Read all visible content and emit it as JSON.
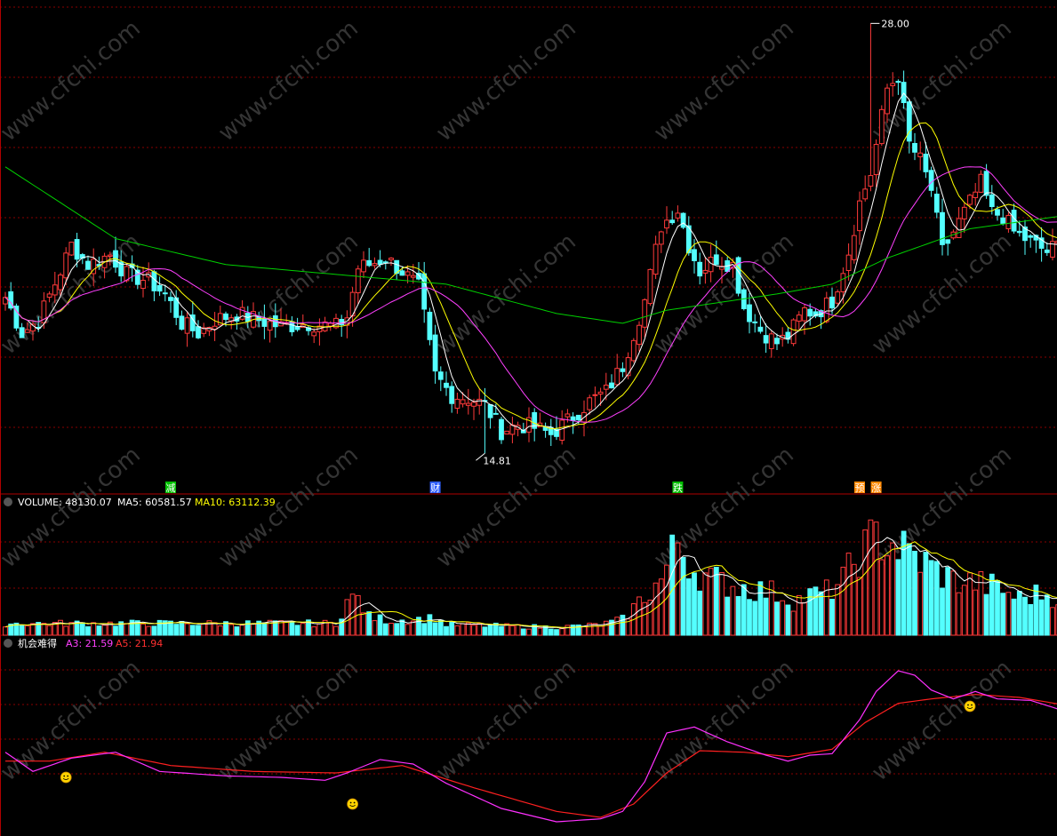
{
  "colors": {
    "background": "#000000",
    "grid": "#8a0000",
    "up": "#ff3a3a",
    "down": "#54ffff",
    "ma_white": "#ffffff",
    "ma_yellow": "#ffff00",
    "ma_magenta": "#ff40ff",
    "ma_green": "#00d000",
    "a3": "#ff30ff",
    "a5": "#ff2020",
    "smiley": "#ffd400",
    "text_white": "#ffffff",
    "text_yellow": "#ffff00",
    "text_magenta": "#ff40ff",
    "text_red": "#ff3030"
  },
  "watermark": "www.cfchi.com",
  "price_panel": {
    "high_label": "28.00",
    "low_label": "14.81",
    "signals": [
      {
        "text": "减",
        "index": 30,
        "color": "#00c000"
      },
      {
        "text": "财",
        "index": 78,
        "color": "#3060ff"
      },
      {
        "text": "跌",
        "index": 122,
        "color": "#00c000"
      },
      {
        "text": "预",
        "index": 155,
        "color": "#ff8800"
      },
      {
        "text": "涨",
        "index": 158,
        "color": "#ff8800"
      }
    ]
  },
  "volume_panel": {
    "title": "VOLUME: 48130.07",
    "ma5_label": "MA5: 60581.57",
    "ma10_label": "MA10: 63112.39"
  },
  "indicator_panel": {
    "title": "机会难得",
    "a3_label": "A3: 21.59",
    "a5_label": "A5: 21.94",
    "smileys": [
      {
        "index": 11,
        "value": 17.6
      },
      {
        "index": 63,
        "value": 15.8
      },
      {
        "index": 175,
        "value": 22.4
      }
    ]
  },
  "chart_data": {
    "type": "candlestick",
    "count": 193,
    "price_range": [
      14.0,
      28.5
    ],
    "volume_range": [
      0,
      95000
    ],
    "indicator_range": [
      14,
      26
    ],
    "close_keypoints": [
      [
        0,
        19.6
      ],
      [
        3,
        18.5
      ],
      [
        6,
        18.9
      ],
      [
        10,
        20.4
      ],
      [
        12,
        21.2
      ],
      [
        15,
        20.6
      ],
      [
        19,
        20.9
      ],
      [
        22,
        20.3
      ],
      [
        26,
        20.1
      ],
      [
        29,
        19.7
      ],
      [
        32,
        18.8
      ],
      [
        35,
        18.5
      ],
      [
        38,
        18.9
      ],
      [
        42,
        19.1
      ],
      [
        46,
        18.9
      ],
      [
        50,
        18.7
      ],
      [
        55,
        18.8
      ],
      [
        60,
        18.7
      ],
      [
        62,
        19.0
      ],
      [
        64,
        20.5
      ],
      [
        66,
        20.6
      ],
      [
        69,
        20.8
      ],
      [
        72,
        20.4
      ],
      [
        75,
        19.9
      ],
      [
        78,
        17.2
      ],
      [
        81,
        16.6
      ],
      [
        84,
        16.5
      ],
      [
        87,
        16.3
      ],
      [
        90,
        15.5
      ],
      [
        93,
        15.7
      ],
      [
        96,
        15.6
      ],
      [
        99,
        15.4
      ],
      [
        102,
        15.8
      ],
      [
        106,
        16.4
      ],
      [
        109,
        16.7
      ],
      [
        112,
        17.5
      ],
      [
        116,
        19.5
      ],
      [
        119,
        21.8
      ],
      [
        122,
        22.3
      ],
      [
        124,
        21.2
      ],
      [
        126,
        20.4
      ],
      [
        129,
        20.8
      ],
      [
        132,
        20.6
      ],
      [
        134,
        19.3
      ],
      [
        137,
        18.6
      ],
      [
        140,
        18.2
      ],
      [
        142,
        18.4
      ],
      [
        145,
        19.2
      ],
      [
        147,
        19.1
      ],
      [
        150,
        19.5
      ],
      [
        153,
        21.0
      ],
      [
        155,
        22.5
      ],
      [
        157,
        23.4
      ],
      [
        160,
        26.0
      ],
      [
        162,
        26.4
      ],
      [
        164,
        24.3
      ],
      [
        166,
        23.8
      ],
      [
        168,
        22.9
      ],
      [
        170,
        21.0
      ],
      [
        172,
        21.6
      ],
      [
        175,
        22.5
      ],
      [
        177,
        23.1
      ],
      [
        179,
        22.2
      ],
      [
        181,
        22.1
      ],
      [
        183,
        21.6
      ],
      [
        186,
        21.3
      ],
      [
        189,
        21.0
      ],
      [
        192,
        21.3
      ]
    ],
    "ma_green_keypoints": [
      [
        0,
        23.6
      ],
      [
        20,
        21.4
      ],
      [
        40,
        20.6
      ],
      [
        60,
        20.3
      ],
      [
        80,
        20.0
      ],
      [
        100,
        19.1
      ],
      [
        112,
        18.8
      ],
      [
        120,
        19.2
      ],
      [
        140,
        19.7
      ],
      [
        150,
        20.0
      ],
      [
        160,
        20.8
      ],
      [
        175,
        21.7
      ],
      [
        192,
        22.1
      ]
    ],
    "volume_series": {
      "base_keypoints": [
        [
          0,
          9000
        ],
        [
          60,
          9000
        ],
        [
          62,
          26000
        ],
        [
          64,
          28000
        ],
        [
          66,
          14000
        ],
        [
          70,
          11000
        ],
        [
          78,
          13000
        ],
        [
          80,
          8000
        ],
        [
          100,
          6000
        ],
        [
          108,
          8000
        ],
        [
          112,
          12000
        ],
        [
          116,
          30000
        ],
        [
          119,
          42000
        ],
        [
          122,
          72000
        ],
        [
          125,
          50000
        ],
        [
          128,
          43000
        ],
        [
          132,
          38000
        ],
        [
          136,
          35000
        ],
        [
          140,
          32000
        ],
        [
          143,
          26000
        ],
        [
          146,
          30000
        ],
        [
          149,
          33000
        ],
        [
          152,
          42000
        ],
        [
          155,
          62000
        ],
        [
          158,
          75000
        ],
        [
          161,
          70000
        ],
        [
          164,
          62000
        ],
        [
          168,
          52000
        ],
        [
          172,
          42000
        ],
        [
          176,
          40000
        ],
        [
          180,
          36000
        ],
        [
          184,
          28000
        ],
        [
          188,
          32000
        ],
        [
          192,
          28000
        ]
      ]
    },
    "indicator": {
      "a3_keypoints": [
        [
          0,
          19.3
        ],
        [
          5,
          18.0
        ],
        [
          12,
          18.9
        ],
        [
          20,
          19.3
        ],
        [
          28,
          18.0
        ],
        [
          40,
          17.7
        ],
        [
          50,
          17.6
        ],
        [
          58,
          17.4
        ],
        [
          62,
          17.9
        ],
        [
          68,
          18.8
        ],
        [
          74,
          18.5
        ],
        [
          80,
          17.2
        ],
        [
          90,
          15.5
        ],
        [
          100,
          14.6
        ],
        [
          108,
          14.8
        ],
        [
          112,
          15.3
        ],
        [
          116,
          17.3
        ],
        [
          120,
          20.6
        ],
        [
          125,
          21.0
        ],
        [
          131,
          20.0
        ],
        [
          138,
          19.1
        ],
        [
          142,
          18.7
        ],
        [
          146,
          19.1
        ],
        [
          150,
          19.2
        ],
        [
          155,
          21.5
        ],
        [
          158,
          23.4
        ],
        [
          162,
          24.8
        ],
        [
          165,
          24.5
        ],
        [
          168,
          23.5
        ],
        [
          172,
          22.9
        ],
        [
          176,
          23.4
        ],
        [
          180,
          22.9
        ],
        [
          186,
          22.8
        ],
        [
          192,
          22.1
        ]
      ],
      "a5_keypoints": [
        [
          0,
          18.7
        ],
        [
          8,
          18.7
        ],
        [
          18,
          19.3
        ],
        [
          30,
          18.4
        ],
        [
          45,
          18.0
        ],
        [
          60,
          17.9
        ],
        [
          72,
          18.4
        ],
        [
          85,
          16.9
        ],
        [
          100,
          15.3
        ],
        [
          108,
          14.9
        ],
        [
          114,
          15.8
        ],
        [
          120,
          17.9
        ],
        [
          126,
          19.4
        ],
        [
          134,
          19.3
        ],
        [
          142,
          19.0
        ],
        [
          150,
          19.5
        ],
        [
          156,
          21.3
        ],
        [
          162,
          22.6
        ],
        [
          168,
          22.9
        ],
        [
          176,
          23.2
        ],
        [
          184,
          23.0
        ],
        [
          192,
          22.5
        ]
      ]
    }
  }
}
